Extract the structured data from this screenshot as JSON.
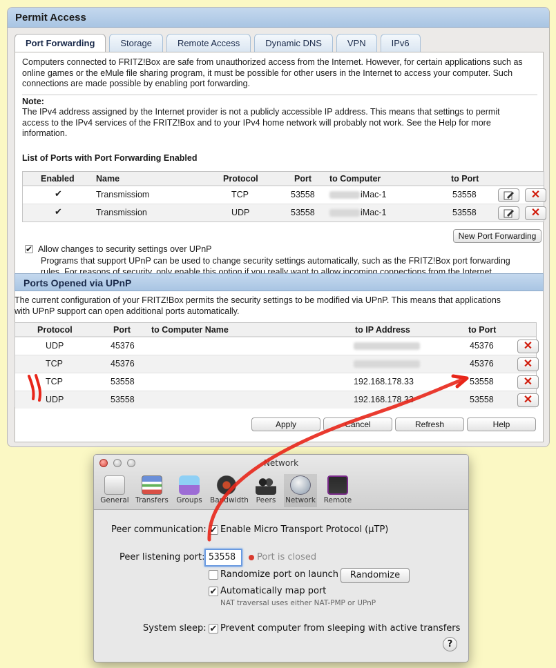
{
  "fritz": {
    "title": "Permit Access",
    "tabs": [
      "Port Forwarding",
      "Storage",
      "Remote Access",
      "Dynamic DNS",
      "VPN",
      "IPv6"
    ],
    "intro_lines": [
      "Computers connected to FRITZ!Box are safe from unauthorized access from the Internet. However, for certain applications such as",
      "online games or the eMule file sharing program, it must be possible for other users in the Internet to access your computer. Such",
      "connections are made possible by enabling port forwarding."
    ],
    "note_label": "Note:",
    "note_lines": [
      "The IPv4 address assigned by the Internet provider is not a publicly accessible IP address. This means that settings to permit",
      "access to the IPv4 services of the FRITZ!Box and to your IPv4 home network will probably not work. See the Help for more",
      "information."
    ],
    "pf_list_title": "List of Ports with Port Forwarding Enabled",
    "pf_headers": {
      "enabled": "Enabled",
      "name": "Name",
      "protocol": "Protocol",
      "port": "Port",
      "to_computer": "to Computer",
      "to_port": "to Port"
    },
    "pf_rows": [
      {
        "enabled": "✔",
        "name": "Transmissiom",
        "protocol": "TCP",
        "port": "53558",
        "computer": "iMac-1",
        "to_port": "53558"
      },
      {
        "enabled": "✔",
        "name": "Transmission",
        "protocol": "UDP",
        "port": "53558",
        "computer": "iMac-1",
        "to_port": "53558"
      }
    ],
    "new_pf_button": "New Port Forwarding",
    "upnp_allow_label": "Allow changes to security settings over UPnP",
    "upnp_allow_desc": [
      "Programs that support UPnP can be used to change security settings automatically, such as the FRITZ!Box port forwarding",
      "rules. For reasons of security, only enable this option if you really want to allow incoming connections from the Internet."
    ],
    "upnp_section_title": "Ports Opened via UPnP",
    "upnp_desc": [
      "The current configuration of your FRITZ!Box permits the security settings to be modified via UPnP. This means that applications",
      "with UPnP support can open additional ports automatically."
    ],
    "upnp_headers": {
      "protocol": "Protocol",
      "port": "Port",
      "computer": "to Computer Name",
      "ip": "to IP Address",
      "to_port": "to Port"
    },
    "upnp_rows": [
      {
        "protocol": "UDP",
        "port": "45376",
        "ip": "",
        "to_port": "45376"
      },
      {
        "protocol": "TCP",
        "port": "45376",
        "ip": "",
        "to_port": "45376"
      },
      {
        "protocol": "TCP",
        "port": "53558",
        "ip": "192.168.178.33",
        "to_port": "53558"
      },
      {
        "protocol": "UDP",
        "port": "53558",
        "ip": "192.168.178.33",
        "to_port": "53558"
      }
    ],
    "buttons": {
      "apply": "Apply",
      "cancel": "Cancel",
      "refresh": "Refresh",
      "help": "Help"
    }
  },
  "mac": {
    "title": "Network",
    "toolbar": [
      "General",
      "Transfers",
      "Groups",
      "Bandwidth",
      "Peers",
      "Network",
      "Remote"
    ],
    "selected_tab": "Network",
    "peer_comm_label": "Peer communication:",
    "utp_label": "Enable Micro Transport Protocol (µTP)",
    "port_label": "Peer listening port:",
    "port_value": "53558",
    "port_status": "Port is closed",
    "randomize_label": "Randomize port on launch",
    "randomize_button": "Randomize",
    "automap_label": "Automatically map port",
    "nat_note": "NAT traversal uses either NAT-PMP or UPnP",
    "sleep_label": "System sleep:",
    "prevent_label": "Prevent computer from sleeping with active transfers",
    "help_glyph": "?",
    "checked_mark": "✔"
  },
  "colors": {
    "annotation_red": "#e8261a",
    "header_blue": "#b4cde8",
    "delete_red": "#d01a0a"
  }
}
